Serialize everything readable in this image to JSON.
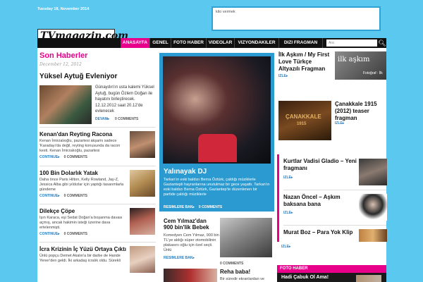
{
  "header": {
    "date": "Tuesday 18, November 2014",
    "ad_text": "kilo vermek",
    "logo_text": "TVmagazin.com"
  },
  "nav": {
    "items": [
      "ANASAYFA",
      "GENEL",
      "FOTO HABER",
      "VIDEOLAR",
      "VIZYONDAKILER",
      "DIZI FRAGMAN"
    ],
    "search_placeholder": "Ara",
    "search_icon": "search-icon"
  },
  "left": {
    "section_title": "Son Haberler",
    "section_date": "December 12, 2012",
    "featured": {
      "title": "Yüksel Aytuğ Evleniyor",
      "body": "Günaydın'ın usta kalemi Yüksel Aytuğ, bugün Özlem Doğan ile hayatını birleştirecek. 12.12.2012 saat 20.12'de evlenecek",
      "more": "DEVAM▸",
      "comments": "0 COMMENTS"
    },
    "items": [
      {
        "title": "Kenan'dan Reyting Racona",
        "body": "Kenan İmirzalıoğlu, pazartesi akşamı sadece 'Karadayı'da değil, reyting konusunda da racon kesti. Kenan İmirzalıoğlu, pazartesi",
        "more": "CONTINUE▸",
        "comments": "0 COMMENTS"
      },
      {
        "title": "100 Bin Dolarlık Yatak",
        "body": "Daha önce Paris Hilton, Kelly Rowland, Jay-Z, Jessica Alba gibi yıldızlar için yaptığı tasarımlarla gündeme",
        "more": "CONTINUE▸",
        "comments": "0 COMMENTS"
      },
      {
        "title": "Dilekçe Çöpe",
        "body": "Işın Karaca, eşi Sedat Doğan'a boşanma davası açmış, ancak hakimin isteği üzerine dava ertelenmişti.",
        "more": "CONTINUE▸",
        "comments": "0 COMMENTS"
      },
      {
        "title": "İcra Krizinin İç Yüzü Ortaya Çıktı",
        "body": "Ünlü popçu Demet Akalın'a bir darbe de Hande Yener'den geldi. İki arkadaş icralık oldu. Sürekli",
        "more": "CONTINUE▸",
        "comments": ""
      }
    ]
  },
  "middle": {
    "big": {
      "title": "Yalınayak DJ",
      "body": "Tarkan'ın eski baldızı Berna Öztürk, çaldığı müziklerle Gaziantepli hayranlarına unutulmaz bir gece yaşattı. Tarkan'ın eski baldızı Berna Öztürk, Gaziantep'te düzenlenen bir partide çaldığı müziklerle",
      "more": "RESIMLERE BAK▸",
      "comments": "0 COMMENTS"
    },
    "item1": {
      "title": "Cem Yılmaz'dan 900 bin'lik Bebek",
      "body": "Komedyen Cem Yılmaz, 900 bin TL'ye aldığı süper otomobilinin plakasını oğlu için özel seçti. Ünlü",
      "more": "RESIMLERE BAK▸",
      "comments": "0 COMMENTS"
    },
    "item2": {
      "title": "Reha baba!",
      "body": "Bir süredir ekranlardan ve"
    }
  },
  "right": {
    "items_top": [
      {
        "title": "İlk Aşkım / My First Love Türkçe Altyazılı Fragman",
        "more": "IZLE▸",
        "img_caption": "ilk aşkım",
        "img_sub": "Fotoğraf : İlk"
      },
      {
        "title": "Çanakkale 1915 (2012) teaser fragman",
        "more": "IZLE▸",
        "img_caption": "ÇANAKKALE",
        "img_sub": "1915"
      }
    ],
    "items_box": [
      {
        "title": "Kurtlar Vadisi Gladio – Yeni fragmanı",
        "more": "IZLE▸"
      },
      {
        "title": "Nazan Öncel – Aşkım baksana bana",
        "more": "IZLE▸"
      },
      {
        "title": "Murat Boz – Para Yok Klip",
        "more": "IZLE▸"
      }
    ],
    "foto_bar": "FOTO HABER",
    "foto_title": "Hadi Çabuk Ol Ama!"
  },
  "colors": {
    "accent": "#e8008a",
    "sky": "#5bc8f0",
    "blue": "#2a9ad0",
    "link": "#2a7ec0"
  }
}
